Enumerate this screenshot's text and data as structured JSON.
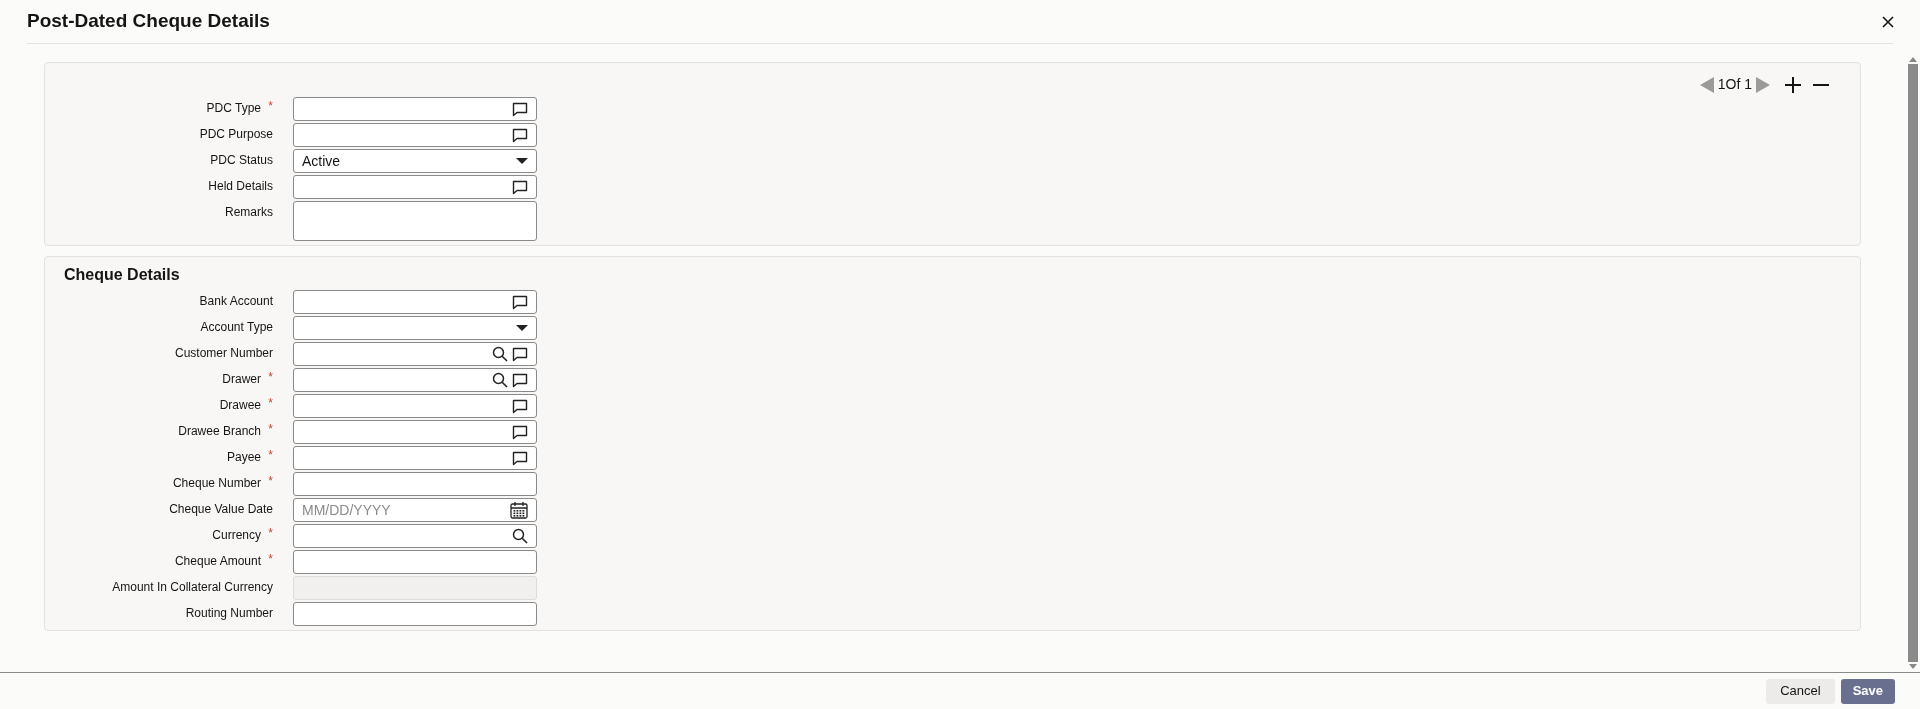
{
  "window": {
    "title": "Post-Dated Cheque Details"
  },
  "pager": {
    "text": "1Of 1"
  },
  "sections": [
    {
      "fields": [
        {
          "label": "PDC Type",
          "required_mark": "*",
          "kind": "detail"
        },
        {
          "label": "PDC Purpose",
          "kind": "detail"
        },
        {
          "label": "PDC Status",
          "kind": "select",
          "value": "Active"
        },
        {
          "label": "Held Details",
          "kind": "detail"
        },
        {
          "label": "Remarks",
          "kind": "textarea"
        }
      ]
    },
    {
      "title": "Cheque Details",
      "fields": [
        {
          "label": "Bank Account",
          "kind": "detail"
        },
        {
          "label": "Account Type",
          "kind": "select"
        },
        {
          "label": "Customer Number",
          "kind": "search-detail"
        },
        {
          "label": "Drawer",
          "required_mark": "*",
          "kind": "search-detail"
        },
        {
          "label": "Drawee",
          "required_mark": "*",
          "kind": "detail"
        },
        {
          "label": "Drawee Branch",
          "required_mark": "*",
          "kind": "detail"
        },
        {
          "label": "Payee",
          "required_mark": "*",
          "kind": "detail"
        },
        {
          "label": "Cheque Number",
          "required_mark": "*",
          "kind": "text"
        },
        {
          "label": "Cheque Value Date",
          "kind": "date",
          "placeholder": "MM/DD/YYYY"
        },
        {
          "label": "Currency",
          "required_mark": "*",
          "kind": "search"
        },
        {
          "label": "Cheque Amount",
          "required_mark": "*",
          "kind": "text"
        },
        {
          "label": "Amount In Collateral Currency",
          "kind": "readonly"
        },
        {
          "label": "Routing Number",
          "kind": "text"
        }
      ]
    }
  ],
  "buttons": [
    {
      "label": "Cancel",
      "kind": "secondary"
    },
    {
      "label": "Save",
      "kind": "primary"
    }
  ]
}
